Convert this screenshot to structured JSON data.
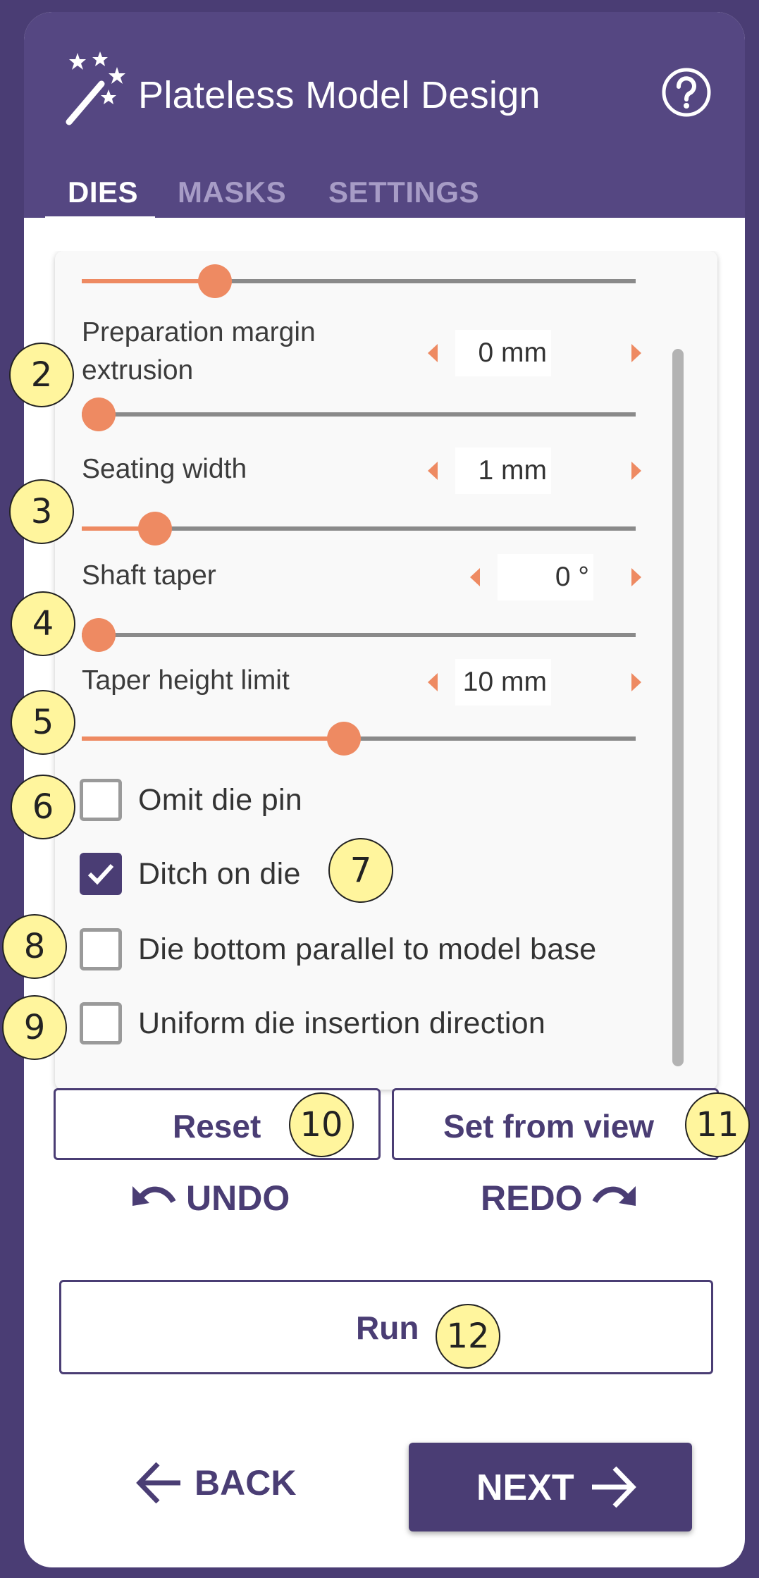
{
  "header": {
    "title": "Plateless Model Design",
    "tabs": [
      {
        "label": "DIES",
        "active": true
      },
      {
        "label": "MASKS",
        "active": false
      },
      {
        "label": "SETTINGS",
        "active": false
      }
    ]
  },
  "settings": {
    "preparation_margin_extrusion": {
      "label": "Preparation margin extrusion",
      "value": "0 mm",
      "slider_fraction": 0.03
    },
    "seating_width": {
      "label": "Seating width",
      "value": "1 mm",
      "slider_fraction": 0.13
    },
    "shaft_taper": {
      "label": "Shaft taper",
      "value": "0 °",
      "slider_fraction": 0.03
    },
    "taper_height_limit": {
      "label": "Taper height limit",
      "value": "10 mm",
      "slider_fraction": 0.47
    },
    "top_slider_fraction": 0.24
  },
  "checkboxes": [
    {
      "label": "Omit die pin",
      "checked": false
    },
    {
      "label": "Ditch on die",
      "checked": true
    },
    {
      "label": "Die bottom parallel to model base",
      "checked": false
    },
    {
      "label": "Uniform die insertion direction",
      "checked": false
    }
  ],
  "buttons": {
    "reset": "Reset",
    "set_from_view": "Set from view",
    "undo": "UNDO",
    "redo": "REDO",
    "run": "Run",
    "back": "BACK",
    "next": "NEXT"
  },
  "badges": [
    "2",
    "3",
    "4",
    "5",
    "6",
    "7",
    "8",
    "9",
    "10",
    "11",
    "12"
  ],
  "colors": {
    "header": "#554782",
    "accent": "#ee8a62",
    "primary": "#4a3d74",
    "badge": "#fff59d"
  }
}
